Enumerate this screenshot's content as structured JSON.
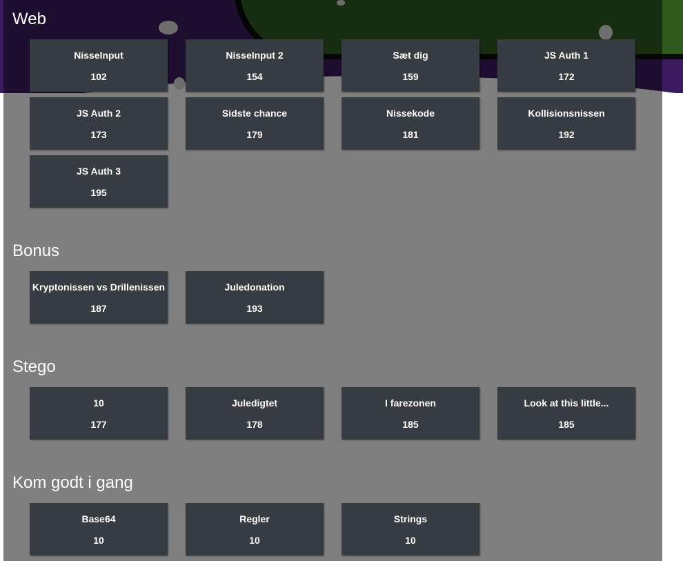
{
  "categories": [
    {
      "title": "Web",
      "challenges": [
        {
          "name": "NisseInput",
          "points": "102"
        },
        {
          "name": "NisseInput 2",
          "points": "154"
        },
        {
          "name": "Sæt dig",
          "points": "159"
        },
        {
          "name": "JS Auth 1",
          "points": "172"
        },
        {
          "name": "JS Auth 2",
          "points": "173"
        },
        {
          "name": "Sidste chance",
          "points": "179"
        },
        {
          "name": "Nissekode",
          "points": "181"
        },
        {
          "name": "Kollisionsnissen",
          "points": "192"
        },
        {
          "name": "JS Auth 3",
          "points": "195"
        }
      ]
    },
    {
      "title": "Bonus",
      "challenges": [
        {
          "name": "Kryptonissen vs Drillenissen",
          "points": "187"
        },
        {
          "name": "Juledonation",
          "points": "193"
        }
      ]
    },
    {
      "title": "Stego",
      "challenges": [
        {
          "name": "10",
          "points": "177"
        },
        {
          "name": "Juledigtet",
          "points": "178"
        },
        {
          "name": "I farezonen",
          "points": "185"
        },
        {
          "name": "Look at this little...",
          "points": "185"
        }
      ]
    },
    {
      "title": "Kom godt i gang",
      "challenges": [
        {
          "name": "Base64",
          "points": "10"
        },
        {
          "name": "Regler",
          "points": "10"
        },
        {
          "name": "Strings",
          "points": "10"
        }
      ]
    }
  ]
}
